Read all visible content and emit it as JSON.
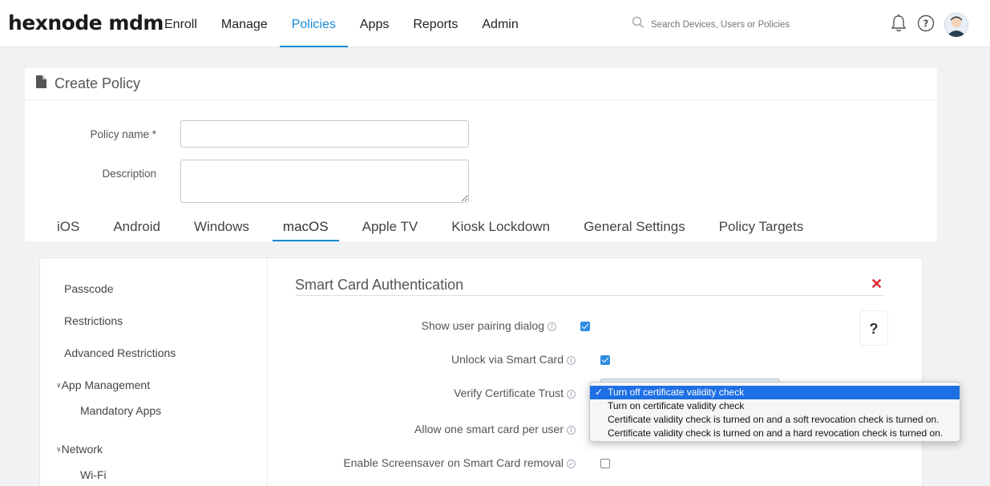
{
  "header": {
    "brand": "hexnode mdm",
    "nav": [
      "Enroll",
      "Manage",
      "Policies",
      "Apps",
      "Reports",
      "Admin"
    ],
    "active_nav": "Policies",
    "search_placeholder": "Search Devices, Users or Policies",
    "icons": [
      "search-icon",
      "bell-icon",
      "help-circle-icon",
      "avatar"
    ]
  },
  "page": {
    "title": "Create Policy",
    "policy_name_label": "Policy name *",
    "policy_name_value": "",
    "description_label": "Description",
    "description_value": ""
  },
  "tabs": [
    "iOS",
    "Android",
    "Windows",
    "macOS",
    "Apple TV",
    "Kiosk Lockdown",
    "General Settings",
    "Policy Targets"
  ],
  "active_tab": "macOS",
  "sidebar": {
    "items": [
      "Passcode",
      "Restrictions",
      "Advanced Restrictions"
    ],
    "group_app": "App Management",
    "group_app_items": [
      "Mandatory Apps"
    ],
    "group_network": "Network",
    "group_network_items": [
      "Wi-Fi"
    ]
  },
  "section": {
    "title": "Smart Card Authentication",
    "help": "?",
    "options": [
      {
        "label": "Show user pairing dialog",
        "checked": true
      },
      {
        "label": "Unlock via Smart Card",
        "checked": true
      },
      {
        "label": "Verify Certificate Trust",
        "type": "select"
      },
      {
        "label": "Allow one smart card per user",
        "type": "select"
      },
      {
        "label": "Enable Screensaver on Smart Card removal",
        "checked": false
      }
    ]
  },
  "dropdown": {
    "options": [
      "Turn off certificate validity check",
      "Turn on certificate validity check",
      "Certificate validity check is turned on and a soft revocation check is turned on.",
      "Certificate validity check is turned on and a hard revocation check is turned on."
    ],
    "selected_index": 0,
    "check_glyph": "✓"
  },
  "colors": {
    "accent": "#1a8bd6",
    "checkbox": "#2f8ee0",
    "close": "#e0242e",
    "dropdown_selected": "#1e6fe3"
  }
}
